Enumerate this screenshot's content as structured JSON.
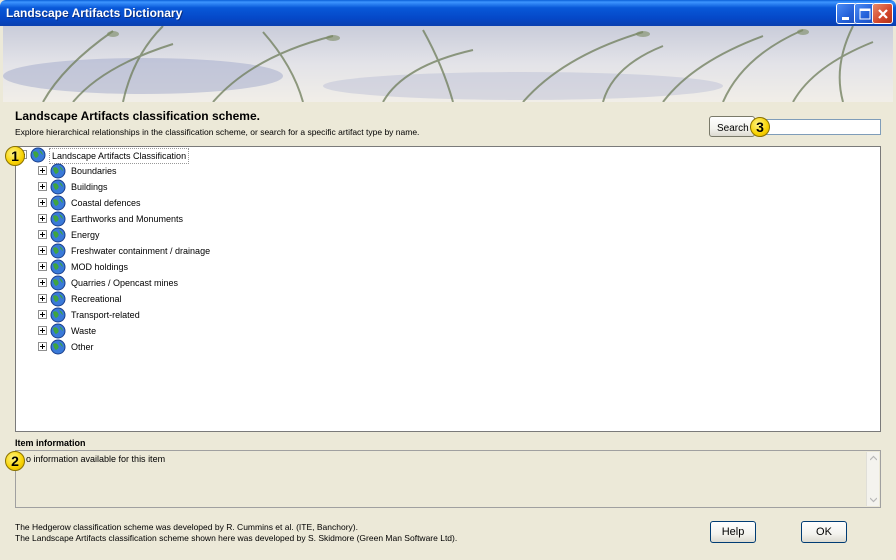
{
  "window": {
    "title": "Landscape Artifacts Dictionary"
  },
  "header": {
    "title": "Landscape Artifacts classification scheme.",
    "subtitle": "Explore hierarchical relationships in the classification scheme, or search for a specific artifact type by name."
  },
  "search": {
    "button_label": "Search",
    "value": ""
  },
  "tree": {
    "root": "Landscape Artifacts Classification",
    "items": [
      "Boundaries",
      "Buildings",
      "Coastal defences",
      "Earthworks and Monuments",
      "Energy",
      "Freshwater containment / drainage",
      "MOD holdings",
      "Quarries / Opencast mines",
      "Recreational",
      "Transport-related",
      "Waste",
      "Other"
    ]
  },
  "callouts": [
    "1",
    "2",
    "3"
  ],
  "item_info": {
    "label": "Item information",
    "text": "o information available for this item"
  },
  "footer": {
    "credit_1": "The Hedgerow classification scheme was developed by R. Cummins et al. (ITE, Banchory).",
    "credit_2": "The Landscape Artifacts classification scheme shown here was developed by S. Skidmore (Green Man Software Ltd).",
    "help_label": "Help",
    "ok_label": "OK"
  },
  "colors": {
    "titlebar": "#0548C8",
    "window_bg": "#ECE9D8",
    "callout": "#F8D200"
  }
}
